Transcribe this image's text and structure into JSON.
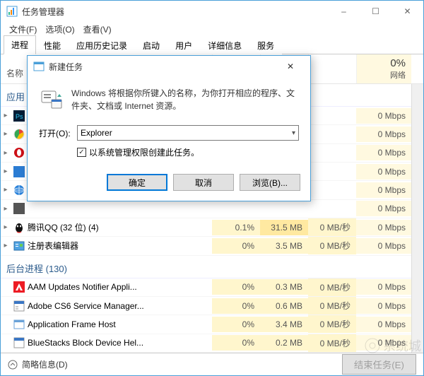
{
  "window": {
    "title": "任务管理器",
    "min": "–",
    "max": "☐",
    "close": "✕"
  },
  "menu": {
    "file": "文件(F)",
    "options": "选项(O)",
    "view": "查看(V)"
  },
  "tabs": {
    "processes": "进程",
    "performance": "性能",
    "history": "应用历史记录",
    "startup": "启动",
    "users": "用户",
    "details": "详细信息",
    "services": "服务"
  },
  "columns": {
    "name": "名称",
    "net_pct": "0%",
    "net_label": "网络"
  },
  "sections": {
    "apps": "应用",
    "bg": "后台进程 (130)"
  },
  "rows": {
    "r1": {
      "name": "",
      "cpu": "",
      "mem": "",
      "disk": "",
      "net": "0 Mbps"
    },
    "r2": {
      "name": "",
      "cpu": "",
      "mem": "",
      "disk": "",
      "net": "0 Mbps"
    },
    "r3": {
      "name": "",
      "cpu": "",
      "mem": "",
      "disk": "",
      "net": "0 Mbps"
    },
    "r4": {
      "name": "",
      "cpu": "",
      "mem": "",
      "disk": "",
      "net": "0 Mbps"
    },
    "r5": {
      "name": "",
      "cpu": "",
      "mem": "",
      "disk": "",
      "net": "0 Mbps"
    },
    "r6": {
      "name": "",
      "cpu": "",
      "mem": "",
      "disk": "",
      "net": "0 Mbps"
    },
    "qq": {
      "name": "腾讯QQ (32 位) (4)",
      "cpu": "0.1%",
      "mem": "31.5 MB",
      "disk": "0 MB/秒",
      "net": "0 Mbps"
    },
    "reg": {
      "name": "注册表编辑器",
      "cpu": "0%",
      "mem": "3.5 MB",
      "disk": "0 MB/秒",
      "net": "0 Mbps"
    },
    "aam": {
      "name": "AAM Updates Notifier Appli...",
      "cpu": "0%",
      "mem": "0.3 MB",
      "disk": "0 MB/秒",
      "net": "0 Mbps"
    },
    "cs6": {
      "name": "Adobe CS6 Service Manager...",
      "cpu": "0%",
      "mem": "0.6 MB",
      "disk": "0 MB/秒",
      "net": "0 Mbps"
    },
    "afh": {
      "name": "Application Frame Host",
      "cpu": "0%",
      "mem": "3.4 MB",
      "disk": "0 MB/秒",
      "net": "0 Mbps"
    },
    "bs": {
      "name": "BlueStacks Block Device Hel...",
      "cpu": "0%",
      "mem": "0.2 MB",
      "disk": "0 MB/秒",
      "net": "0 Mbps"
    }
  },
  "statusbar": {
    "fewer": "简略信息(D)",
    "end": "结束任务(E)"
  },
  "dialog": {
    "title": "新建任务",
    "desc": "Windows 将根据你所键入的名称，为你打开相应的程序、文件夹、文档或 Internet 资源。",
    "open_label": "打开(O):",
    "value": "Explorer",
    "admin": "以系统管理权限创建此任务。",
    "ok": "确定",
    "cancel": "取消",
    "browse": "浏览(B)..."
  },
  "watermark": "系统城"
}
